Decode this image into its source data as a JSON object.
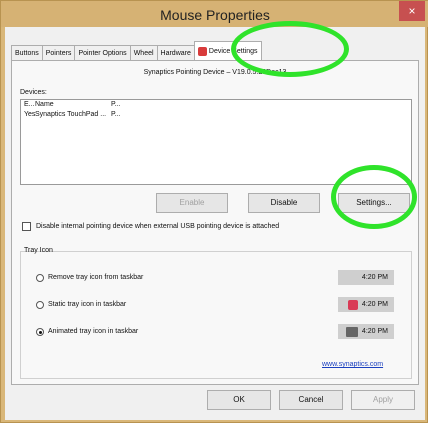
{
  "window": {
    "title": "Mouse Properties",
    "close_glyph": "×"
  },
  "tabs": [
    {
      "label": "Buttons"
    },
    {
      "label": "Pointers"
    },
    {
      "label": "Pointer Options"
    },
    {
      "label": "Wheel"
    },
    {
      "label": "Hardware"
    },
    {
      "label": "Device Settings"
    }
  ],
  "device_header": "Synaptics Pointing Device – V19.0.5.20Dec13",
  "devices": {
    "label": "Devices:",
    "columns": [
      "E...",
      "Name",
      "P..."
    ],
    "rows": [
      {
        "enabled": "Yes",
        "name": "Synaptics TouchPad ...",
        "port": "P..."
      }
    ]
  },
  "buttons": {
    "enable": "Enable",
    "disable": "Disable",
    "settings": "Settings...",
    "ok": "OK",
    "cancel": "Cancel",
    "apply": "Apply"
  },
  "disable_internal_label": "Disable internal pointing device when external USB pointing device is attached",
  "tray": {
    "group_label": "Tray Icon",
    "options": [
      {
        "label": "Remove tray icon from taskbar",
        "time": "4:20 PM",
        "selected": false,
        "icon": "none"
      },
      {
        "label": "Static tray icon in taskbar",
        "time": "4:20 PM",
        "selected": false,
        "icon": "synaptics-static-icon"
      },
      {
        "label": "Animated tray icon in taskbar",
        "time": "4:20 PM",
        "selected": true,
        "icon": "synaptics-animated-icon"
      }
    ]
  },
  "link": "www.synaptics.com",
  "highlight_color": "#2fe32a"
}
